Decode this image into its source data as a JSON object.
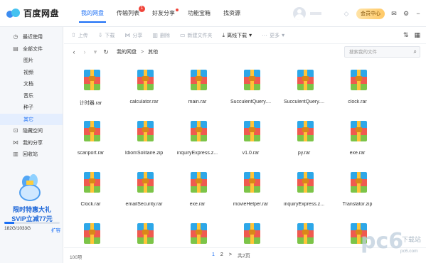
{
  "app": {
    "logo_text": "百度网盘",
    "nav": [
      {
        "label": "我的网盘",
        "active": true
      },
      {
        "label": "传输列表",
        "badge": "1"
      },
      {
        "label": "好友分享",
        "dot": true
      },
      {
        "label": "功能宝箱"
      },
      {
        "label": "找资源"
      }
    ],
    "member_label": "会员中心"
  },
  "sidebar": {
    "items": [
      {
        "label": "最近使用",
        "icon": "clock-icon"
      },
      {
        "label": "全部文件",
        "icon": "file-icon"
      },
      {
        "label": "图片",
        "sub": true
      },
      {
        "label": "视频",
        "sub": true
      },
      {
        "label": "文档",
        "sub": true
      },
      {
        "label": "音乐",
        "sub": true
      },
      {
        "label": "种子",
        "sub": true
      },
      {
        "label": "其它",
        "sub": true,
        "active": true
      },
      {
        "label": "隐藏空间",
        "icon": "lock-icon"
      },
      {
        "label": "我的分享",
        "icon": "share-icon"
      },
      {
        "label": "回收站",
        "icon": "trash-icon"
      }
    ],
    "promo_line1": "限时特惠大礼",
    "promo_line2": "SVIP立减77元",
    "storage_text": "182G/1033G",
    "storage_used_fraction": 0.176,
    "expand_label": "扩容"
  },
  "toolbar": {
    "upload": "上传",
    "download": "下载",
    "share": "分享",
    "delete": "删除",
    "new_folder": "新建文件夹",
    "offline_download": "离线下载",
    "more": "更多"
  },
  "path": {
    "crumbs": [
      "我的网盘",
      "其他"
    ],
    "separator": ">",
    "search_placeholder": "搜索我的文件"
  },
  "files": [
    "计时器.rar",
    "calculator.rar",
    "main.rar",
    "SucculentQuery....",
    "SucculentQuery....",
    "clock.rar",
    "scanport.rar",
    "IdiomSolitaire.zip",
    "inquiryExpress.z...",
    "v1.0.rar",
    "py.rar",
    "exe.rar",
    "Clock.rar",
    "emailSecurity.rar",
    "exe.rar",
    "movieHelper.rar",
    "inquiryExpress.z...",
    "Translator.zip",
    "",
    "",
    "",
    "",
    "",
    ""
  ],
  "footer": {
    "count": "100项",
    "pages": [
      "1",
      "2"
    ],
    "next": ">",
    "total": "共2页"
  },
  "watermark": {
    "big": "pc6",
    "small": "下载站",
    "url": "pc6.com"
  },
  "colors": {
    "accent": "#1b6ff5",
    "sidebar_bg": "#f5f7fa"
  }
}
